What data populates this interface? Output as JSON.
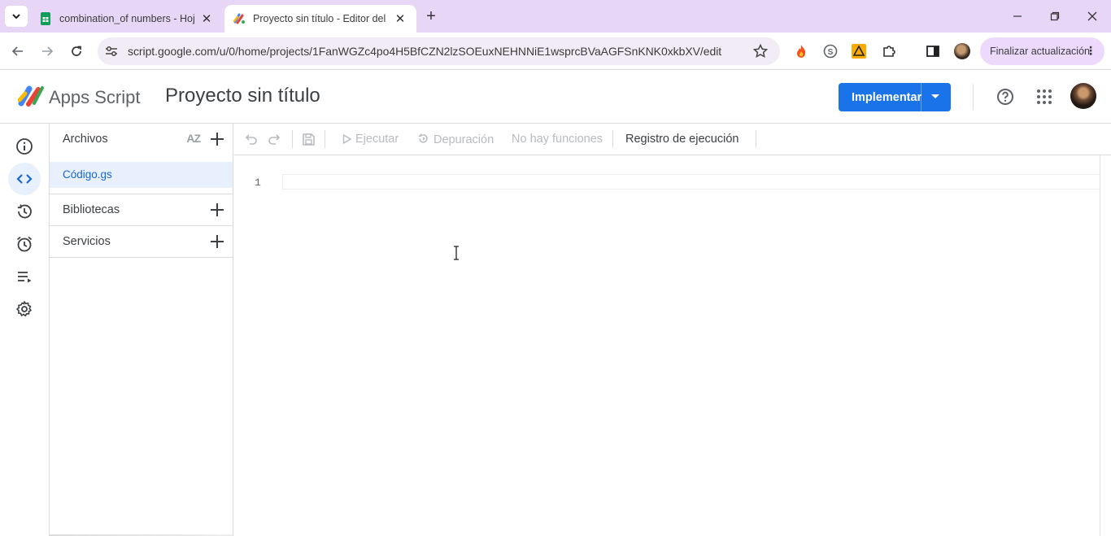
{
  "browser": {
    "tabs": [
      {
        "title": "combination_of numbers - Hoja de cálculo",
        "icon": "sheets-icon",
        "active": false
      },
      {
        "title": "Proyecto sin título - Editor del proyecto",
        "icon": "apps-script-icon",
        "active": true
      }
    ],
    "url": "script.google.com/u/0/home/projects/1FanWGZc4po4H5BfCZN2lzSOEuxNEHNNiE1wsprcBVaAGFSnKNK0xkbXV/edit",
    "update_button": "Finalizar actualización"
  },
  "app": {
    "brand": "Apps Script",
    "project_name": "Proyecto sin título",
    "deploy_label": "Implementar",
    "accent_color": "#1a73e8"
  },
  "sidebar": {
    "files_title": "Archivos",
    "sort_label": "AZ",
    "files": [
      "Código.gs"
    ],
    "libraries_title": "Bibliotecas",
    "services_title": "Servicios"
  },
  "editor_toolbar": {
    "run": "Ejecutar",
    "debug": "Depuración",
    "functions": "No hay funciones",
    "exec_log": "Registro de ejecución"
  },
  "editor": {
    "line_numbers": [
      "1"
    ]
  }
}
